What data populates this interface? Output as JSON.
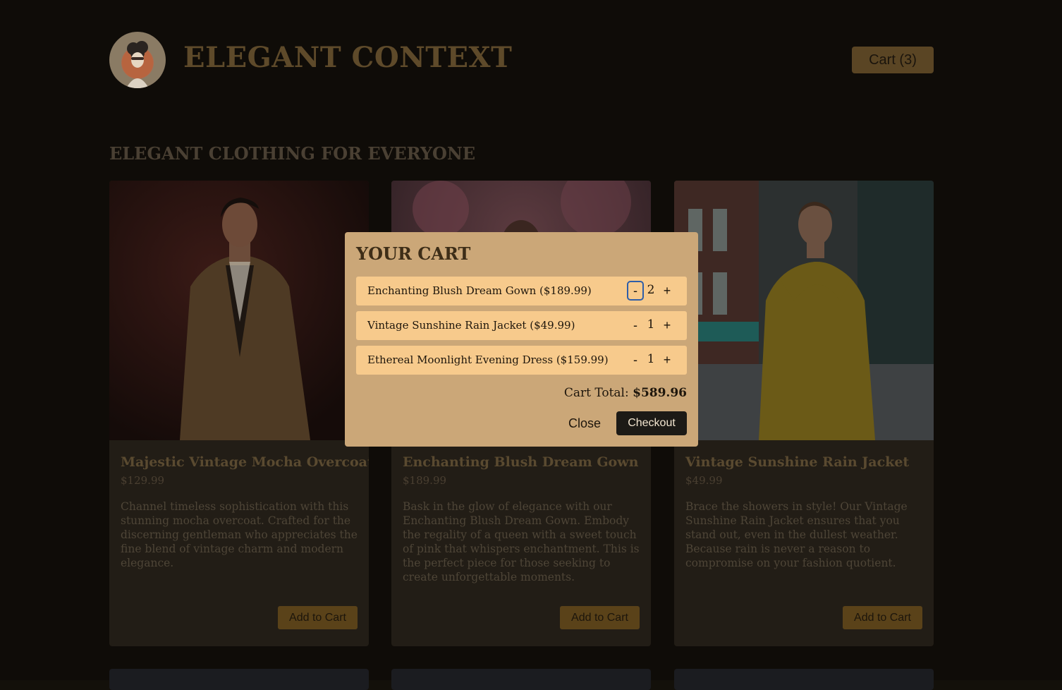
{
  "header": {
    "brand": "ELEGANT CONTEXT",
    "cart_button": "Cart (3)",
    "logo_icon": "vintage-woman-logo-icon"
  },
  "section": {
    "title": "ELEGANT CLOTHING FOR EVERYONE"
  },
  "products": [
    {
      "name": "Majestic Vintage Mocha Overcoat",
      "price": "$129.99",
      "description": "Channel timeless sophistication with this stunning mocha overcoat. Crafted for the discerning gentleman who appreciates the fine blend of vintage charm and modern elegance.",
      "add_label": "Add to Cart"
    },
    {
      "name": "Enchanting Blush Dream Gown",
      "price": "$189.99",
      "description": "Bask in the glow of elegance with our Enchanting Blush Dream Gown. Embody the regality of a queen with a sweet touch of pink that whispers enchantment. This is the perfect piece for those seeking to create unforgettable moments.",
      "add_label": "Add to Cart"
    },
    {
      "name": "Vintage Sunshine Rain Jacket",
      "price": "$49.99",
      "description": "Brace the showers in style! Our Vintage Sunshine Rain Jacket ensures that you stand out, even in the dullest weather. Because rain is never a reason to compromise on your fashion quotient.",
      "add_label": "Add to Cart"
    }
  ],
  "cart": {
    "title": "YOUR CART",
    "items": [
      {
        "label": "Enchanting Blush Dream Gown ($189.99)",
        "quantity": "2"
      },
      {
        "label": "Vintage Sunshine Rain Jacket ($49.99)",
        "quantity": "1"
      },
      {
        "label": "Ethereal Moonlight Evening Dress ($159.99)",
        "quantity": "1"
      }
    ],
    "minus_label": "-",
    "plus_label": "+",
    "total_label": "Cart Total:",
    "total_value": "$589.96",
    "close_label": "Close",
    "checkout_label": "Checkout"
  }
}
